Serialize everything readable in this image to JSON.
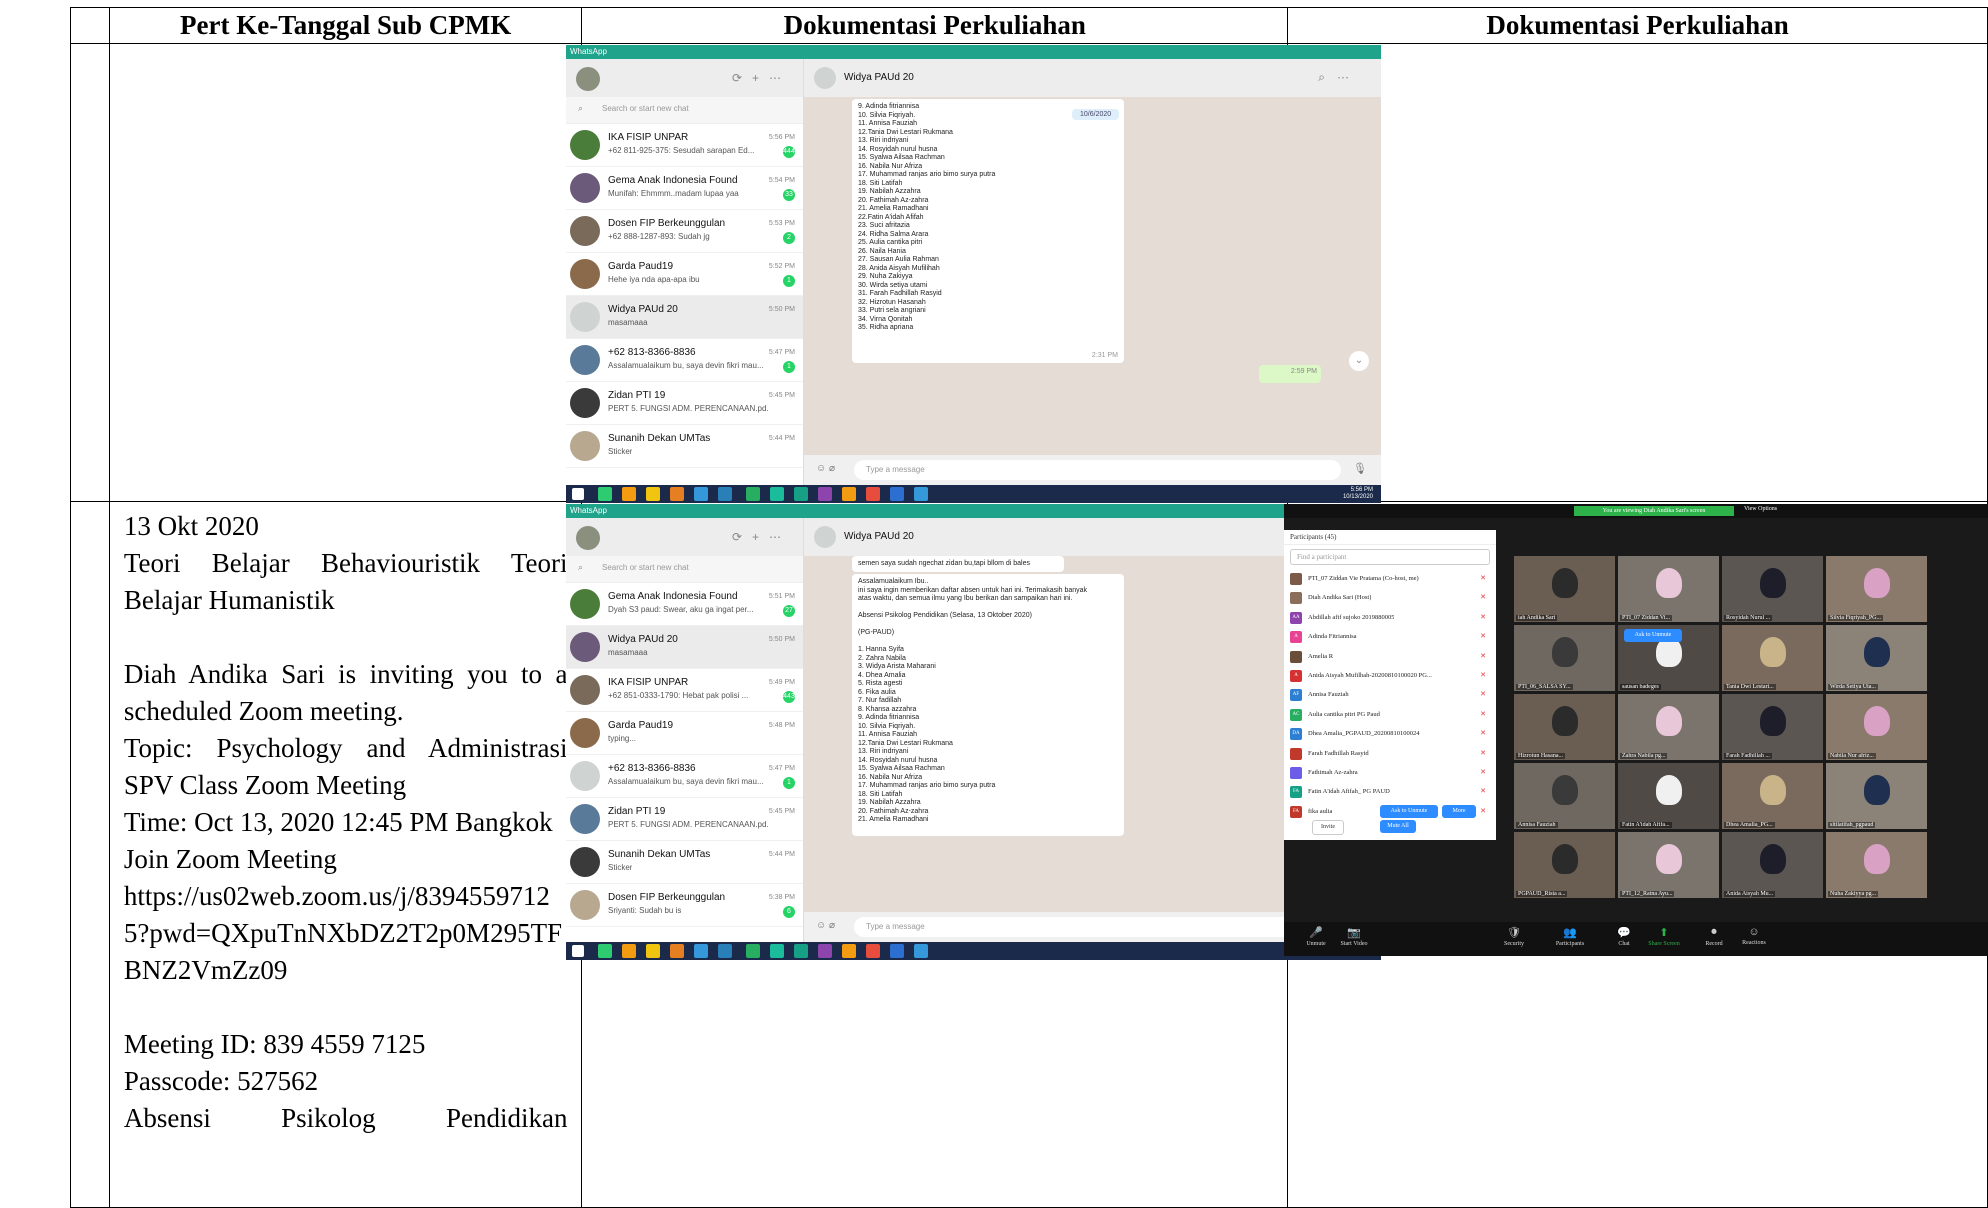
{
  "table": {
    "headers": [
      "Pert Ke-Tanggal Sub CPMK",
      "Dokumentasi Perkuliahan",
      "Dokumentasi Perkuliahan"
    ],
    "row2": {
      "date": "13 Okt 2020",
      "topic": "Teori Belajar Behaviouristik Teori Belajar Humanistik",
      "invite": "Diah Andika Sari is inviting you to a scheduled Zoom meeting.",
      "zoom_topic": "Topic: Psychology and Administrasi SPV Class Zoom Meeting",
      "time": "Time: Oct 13, 2020 12:45 PM Bangkok",
      "join": "Join Zoom Meeting",
      "url": "https://us02web.zoom.us/j/83945597125?pwd=QXpuTnNXbDZ2T2p0M295TFBNZ2VmZz09",
      "meeting_id": "Meeting ID: 839 4559 7125",
      "passcode": "Passcode: 527562",
      "absensi": "Absensi Psikolog Pendidikan"
    }
  },
  "whatsapp1": {
    "app": "WhatsApp",
    "search_placeholder": "Search or start new chat",
    "chat_title": "Widya PAUd 20",
    "chats": [
      {
        "name": "IKA FISIP UNPAR",
        "preview": "+62 811-925-375: Sesudah sarapan Ed...",
        "time": "5:56 PM",
        "badge": "444"
      },
      {
        "name": "Gema Anak Indonesia Found",
        "preview": "Munifah: Ehmmm..madam lupaa yaa",
        "time": "5:54 PM",
        "badge": "33"
      },
      {
        "name": "Dosen FIP Berkeunggulan",
        "preview": "+62 888-1287-893: Sudah jg",
        "time": "5:53 PM",
        "badge": "2"
      },
      {
        "name": "Garda Paud19",
        "preview": "Hehe iya nda apa-apa ibu",
        "time": "5:52 PM",
        "badge": "1"
      },
      {
        "name": "Widya PAUd 20",
        "preview": "masamaaa",
        "time": "5:50 PM",
        "badge": ""
      },
      {
        "name": "+62 813-8366-8836",
        "preview": "Assalamualaikum bu, saya devin fikri mau...",
        "time": "5:47 PM",
        "badge": "1"
      },
      {
        "name": "Zidan PTI 19",
        "preview": "PERT 5. FUNGSI ADM. PERENCANAAN.pd...",
        "time": "5:45 PM",
        "badge": ""
      },
      {
        "name": "Sunanih Dekan UMTas",
        "preview": "Sticker",
        "time": "5:44 PM",
        "badge": ""
      }
    ],
    "date_badge": "10/6/2020",
    "message_lines": [
      "9. Adinda fitriannisa",
      "10. Silvia Fiqriyah.",
      "11. Annisa Fauziah",
      "12.Tania Dwi Lestari Rukmana",
      "13. Riri indriyani",
      "14. Rosyidah nurul husna",
      "15. Syalwa Ailsaa Rachman",
      "16. Nabila Nur Afriza",
      "17. Muhammad ranjas ario bimo surya putra",
      "18. Siti Latifah",
      "19. Nabilah Azzahra",
      "20. Fathimah Az-zahra",
      "21. Amelia Ramadhani",
      "22.Fatin A'idah Afifah",
      "23. Suci afritazia",
      "24. Ridha Salma Arara",
      "25. Aulia cantika pitri",
      "26. Naila Hania",
      "27. Sausan Aulia Rahman",
      "28. Anida Aisyah Mufilihah",
      "29. Nuha Zakiyya",
      "30. Wirda setiya utami",
      "31. Farah Fadhillah Rasyid",
      "32. Hizrotun Hasanah",
      "33. Putri sela angriani",
      "34. Virna Qonitah",
      "35. Ridha apriana"
    ],
    "msg_time": "2:31 PM",
    "out_time": "2:59 PM",
    "input_placeholder": "Type a message",
    "clock_time": "5:56 PM",
    "clock_date": "10/13/2020"
  },
  "whatsapp2": {
    "app": "WhatsApp",
    "search_placeholder": "Search or start new chat",
    "chat_title": "Widya PAUd 20",
    "chats": [
      {
        "name": "Gema Anak Indonesia Found",
        "preview": "Dyah S3 paud: Swear, aku ga ingat per...",
        "time": "5:51 PM",
        "badge": "27"
      },
      {
        "name": "Widya PAUd 20",
        "preview": "masamaaa",
        "time": "5:50 PM",
        "badge": ""
      },
      {
        "name": "IKA FISIP UNPAR",
        "preview": "+62 851-0333-1790: Hebat pak polisi ...",
        "time": "5:49 PM",
        "badge": "443"
      },
      {
        "name": "Garda Paud19",
        "preview": "typing...",
        "time": "5:48 PM",
        "badge": ""
      },
      {
        "name": "+62 813-8366-8836",
        "preview": "Assalamualaikum bu, saya devin fikri mau...",
        "time": "5:47 PM",
        "badge": "1"
      },
      {
        "name": "Zidan PTI 19",
        "preview": "PERT 5. FUNGSI ADM. PERENCANAAN.pd...",
        "time": "5:45 PM",
        "badge": ""
      },
      {
        "name": "Sunanih Dekan UMTas",
        "preview": "Sticker",
        "time": "5:44 PM",
        "badge": ""
      },
      {
        "name": "Dosen FIP Berkeunggulan",
        "preview": "Sriyanti: Sudah bu is",
        "time": "5:38 PM",
        "badge": "6"
      }
    ],
    "top_message": "semen saya sudah ngechat zidan bu,tapi bllom di bales",
    "top_time": "1:14 PM",
    "message_lines": [
      "Assalamualaikum Ibu..",
      "ini saya ingin memberikan daftar absen untuk hari ini. Terimakasih banyak",
      "atas waktu, dan semua ilmu yang Ibu berikan dan sampaikan hari ini.",
      "",
      "Absensi Psikolog Pendidikan (Selasa, 13 Oktober 2020)",
      "",
      "(PG-PAUD)",
      "",
      "1. Hanna Syifa",
      "2. Zahra Nabila",
      "3. Widya Arista Maharani",
      "4. Dhea Amalia",
      "5. Rista agesti",
      "6. Fika aulia",
      "7. Nur fadillah",
      "8. Khansa azzahra",
      "9. Adinda fitriannisa",
      "10. Silvia Fiqriyah.",
      "11. Annisa Fauziah",
      "12.Tania Dwi Lestari Rukmana",
      "13. Riri indriyani",
      "14. Rosyidah nurul husna",
      "15. Syalwa Ailsaa Rachman",
      "16. Nabila Nur Afriza",
      "17. Muhammad ranjas ario bimo surya putra",
      "18. Siti Latifah",
      "19. Nabilah Azzahra",
      "20. Fathimah Az-zahra",
      "21. Amelia Ramadhani"
    ],
    "input_placeholder": "Type a message"
  },
  "zoom": {
    "banner": "You are viewing Diah Andika Sari's screen",
    "view_options": "View Options",
    "panel_title": "Participants (45)",
    "find_placeholder": "Find a participant",
    "participants": [
      {
        "name": "PTI_07 Ziddan Vie Pratama (Co-host, me)",
        "color": "#7b5a4a"
      },
      {
        "name": "Diah Andika Sari (Host)",
        "color": "#8b6d5a"
      },
      {
        "name": "Abdillah afif sujoko 2019880005",
        "initials": "AA",
        "color": "#8e44ad"
      },
      {
        "name": "Adinda Fitriannisa",
        "initials": "A",
        "color": "#e84393"
      },
      {
        "name": "Amelia R",
        "color": "#6b4e3a"
      },
      {
        "name": "Anida Aisyah Mufilhah-20200810100020 PG...",
        "initials": "A",
        "color": "#d63031"
      },
      {
        "name": "Annisa Fauziah",
        "initials": "AF",
        "color": "#2d7fd3"
      },
      {
        "name": "Aulia cantika pitri PG Paud",
        "initials": "AC",
        "color": "#27ae60"
      },
      {
        "name": "Dhea Amalia_PGPAUD_20200810100024",
        "initials": "DA",
        "color": "#2d7fd3"
      },
      {
        "name": "Farah Fadhillah Rasyid",
        "color": "#c0392b"
      },
      {
        "name": "Fathimah Az-zahra",
        "color": "#6c5ce7"
      },
      {
        "name": "Fatin A'idah Afifah_ PG PAUD",
        "initials": "FA",
        "color": "#16a085"
      },
      {
        "name": "fika aulia",
        "initials": "FA",
        "color": "#c0392b"
      }
    ],
    "ask_unmute": "Ask to Unmute",
    "more": "More",
    "invite": "Invite",
    "mute_all": "Mute All",
    "tiles": [
      "iah Andika Sari",
      "PTI_07 Ziddan Vi...",
      "Rosyidah Nurul ...",
      "Silvia Fiqriyah_PG...",
      "PTI_06_SALSA SY...",
      "sausan badeges",
      "Tania Dwi Lestari...",
      "Wirda Setiya Uta...",
      "Hizrotun Hasana...",
      "Zahra Nabila pg...",
      "Farah Fadhillah ...",
      "Nabila Nur afriz...",
      "Annisa Fauziah",
      "Fatin A'idah Afifa...",
      "Dhea Amalia_PG...",
      "sitilatifah_pgpaud",
      "PGPAUD_Rista a...",
      "PTI_12_Ratna Ayu...",
      "Anida Aisyah Mu...",
      "Nuha Zakiyya pg..."
    ],
    "tile_ask_unmute": "Ask to Unmute",
    "toolbar": [
      "Unmute",
      "Start Video",
      "Security",
      "Participants",
      "Chat",
      "Share Screen",
      "Record",
      "Reactions"
    ],
    "participant_count": "45"
  }
}
